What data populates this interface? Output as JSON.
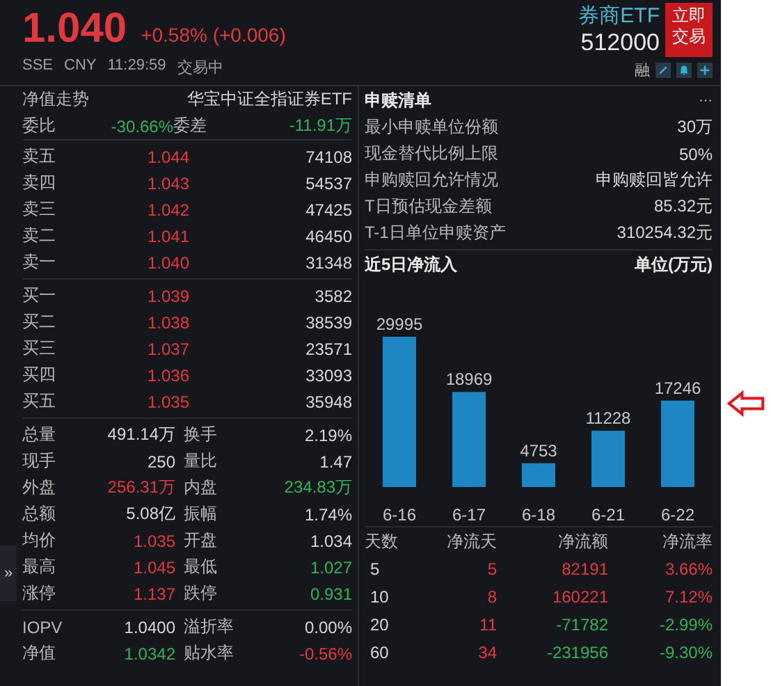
{
  "header": {
    "price": "1.040",
    "change": "+0.58% (+0.006)",
    "color": "#e2393f",
    "name": "券商ETF",
    "code": "512000",
    "trade_button": [
      "立即",
      "交易"
    ],
    "meta": [
      "SSE",
      "CNY",
      "11:29:59",
      "交易中"
    ],
    "margin_label": "融"
  },
  "quote": {
    "title": "净值走势",
    "fund_name": "华宝中证全指证券ETF",
    "ratio": [
      {
        "label": "委比",
        "value": "-30.66%",
        "color": "#2fb35b"
      },
      {
        "label": "委差",
        "value": "-11.91万",
        "color": "#2fb35b"
      }
    ],
    "asks": [
      {
        "label": "卖五",
        "price": "1.044",
        "volume": "74108"
      },
      {
        "label": "卖四",
        "price": "1.043",
        "volume": "54537"
      },
      {
        "label": "卖三",
        "price": "1.042",
        "volume": "47425"
      },
      {
        "label": "卖二",
        "price": "1.041",
        "volume": "46450"
      },
      {
        "label": "卖一",
        "price": "1.040",
        "volume": "31348"
      }
    ],
    "bids": [
      {
        "label": "买一",
        "price": "1.039",
        "volume": "3582"
      },
      {
        "label": "买二",
        "price": "1.038",
        "volume": "38539"
      },
      {
        "label": "买三",
        "price": "1.037",
        "volume": "23571"
      },
      {
        "label": "买四",
        "price": "1.036",
        "volume": "33093"
      },
      {
        "label": "买五",
        "price": "1.035",
        "volume": "35948"
      }
    ],
    "stats": [
      [
        {
          "label": "总量",
          "value": "491.14万",
          "color": "#d8d8d8"
        },
        {
          "label": "换手",
          "value": "2.19%",
          "color": "#d8d8d8"
        }
      ],
      [
        {
          "label": "现手",
          "value": "250",
          "color": "#d8d8d8"
        },
        {
          "label": "量比",
          "value": "1.47",
          "color": "#d8d8d8"
        }
      ],
      [
        {
          "label": "外盘",
          "value": "256.31万",
          "color": "#e2393f"
        },
        {
          "label": "内盘",
          "value": "234.83万",
          "color": "#2fb35b"
        }
      ],
      [
        {
          "label": "总额",
          "value": "5.08亿",
          "color": "#d8d8d8"
        },
        {
          "label": "振幅",
          "value": "1.74%",
          "color": "#d8d8d8"
        }
      ],
      [
        {
          "label": "均价",
          "value": "1.035",
          "color": "#e2393f"
        },
        {
          "label": "开盘",
          "value": "1.034",
          "color": "#d8d8d8"
        }
      ],
      [
        {
          "label": "最高",
          "value": "1.045",
          "color": "#e2393f"
        },
        {
          "label": "最低",
          "value": "1.027",
          "color": "#2fb35b"
        }
      ],
      [
        {
          "label": "涨停",
          "value": "1.137",
          "color": "#e2393f"
        },
        {
          "label": "跌停",
          "value": "0.931",
          "color": "#2fb35b"
        }
      ]
    ],
    "iopv": [
      [
        {
          "label": "IOPV",
          "value": "1.0400",
          "color": "#d8d8d8"
        },
        {
          "label": "溢折率",
          "value": "0.00%",
          "color": "#d8d8d8"
        }
      ],
      [
        {
          "label": "净值",
          "value": "1.0342",
          "color": "#2fb35b"
        },
        {
          "label": "贴水率",
          "value": "-0.56%",
          "color": "#e2393f"
        }
      ]
    ]
  },
  "side_toggle": "»",
  "subscription": {
    "title": "申赎清单",
    "more": "···",
    "items": [
      {
        "label": "最小申赎单位份额",
        "value": "30万"
      },
      {
        "label": "现金替代比例上限",
        "value": "50%"
      },
      {
        "label": "申购赎回允许情况",
        "value": "申购赎回皆允许"
      },
      {
        "label": "T日预估现金差额",
        "value": "85.32元"
      },
      {
        "label": "T-1日单位申赎资产",
        "value": "310254.32元"
      }
    ]
  },
  "net_inflow": {
    "title": "近5日净流入",
    "unit": "单位(万元)",
    "chart_data": {
      "type": "bar",
      "categories": [
        "6-16",
        "6-17",
        "6-18",
        "6-21",
        "6-22"
      ],
      "values": [
        29995,
        18969,
        4753,
        11228,
        17246
      ],
      "data_labels": true
    },
    "columns": [
      "天数",
      "净流天",
      "净流额",
      "净流率"
    ],
    "rows": [
      {
        "days": "5",
        "net_days": "5",
        "amount": "82191",
        "rate": "3.66%",
        "color": "#e2393f"
      },
      {
        "days": "10",
        "net_days": "8",
        "amount": "160221",
        "rate": "7.12%",
        "color": "#e2393f"
      },
      {
        "days": "20",
        "net_days": "11",
        "amount": "-71782",
        "rate": "-2.99%",
        "color": "#2fb35b"
      },
      {
        "days": "60",
        "net_days": "34",
        "amount": "-231956",
        "rate": "-9.30%",
        "color": "#2fb35b"
      }
    ]
  }
}
